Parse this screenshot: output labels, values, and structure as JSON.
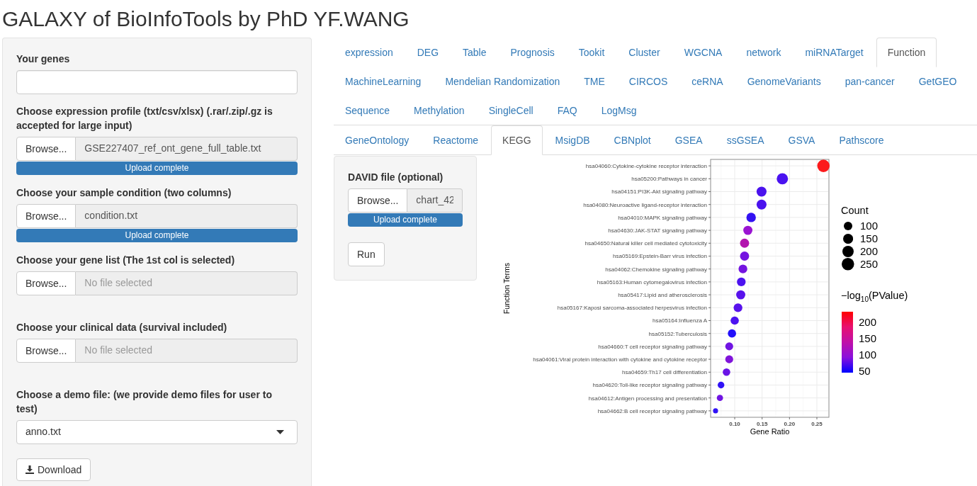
{
  "page_title": "GALAXY of BioInfoTools by PhD YF.WANG",
  "sidebar": {
    "fields": [
      {
        "kind": "text",
        "label": "Your genes"
      },
      {
        "kind": "file",
        "label": "Choose expression profile (txt/csv/xlsx) (.rar/.zip/.gz is accepted for large input)",
        "button": "Browse...",
        "value": "GSE227407_ref_ont_gene_full_table.txt",
        "progress": {
          "label": "Upload complete",
          "level": 1
        }
      },
      {
        "kind": "file",
        "label": "Choose your sample condition (two columns)",
        "button": "Browse...",
        "value": "condition.txt",
        "progress": {
          "label": "Upload complete",
          "level": 1
        }
      },
      {
        "kind": "file",
        "label": "Choose your gene list (The 1st col is selected)",
        "button": "Browse...",
        "placeholder": "No file selected"
      },
      {
        "kind": "file",
        "label": "Choose your clinical data (survival included)",
        "button": "Browse...",
        "placeholder": "No file selected"
      },
      {
        "kind": "select",
        "label": "Choose a demo file: (we provide demo files for user to test)",
        "value": "anno.txt"
      }
    ],
    "download_button": "Download"
  },
  "main_tabs": [
    {
      "label": "expression",
      "selected": false
    },
    {
      "label": "DEG",
      "selected": false
    },
    {
      "label": "Table",
      "selected": false
    },
    {
      "label": "Prognosis",
      "selected": false
    },
    {
      "label": "Tookit",
      "selected": false
    },
    {
      "label": "Cluster",
      "selected": false
    },
    {
      "label": "WGCNA",
      "selected": false
    },
    {
      "label": "network",
      "selected": false
    },
    {
      "label": "miRNATarget",
      "selected": false
    },
    {
      "label": "Function",
      "selected": true
    },
    {
      "label": "MachineLearning",
      "selected": false
    },
    {
      "label": "Mendelian Randomization",
      "selected": false
    },
    {
      "label": "TME",
      "selected": false
    },
    {
      "label": "CIRCOS",
      "selected": false
    },
    {
      "label": "ceRNA",
      "selected": false
    },
    {
      "label": "GenomeVariants",
      "selected": false
    },
    {
      "label": "pan-cancer",
      "selected": false
    },
    {
      "label": "GetGEO",
      "selected": false
    },
    {
      "label": "Sequence",
      "selected": false
    },
    {
      "label": "Methylation",
      "selected": false
    },
    {
      "label": "SingleCell",
      "selected": false
    },
    {
      "label": "FAQ",
      "selected": false
    },
    {
      "label": "LogMsg",
      "selected": false
    }
  ],
  "sub_tabs": [
    {
      "label": "GeneOntology",
      "selected": false
    },
    {
      "label": "Reactome",
      "selected": false
    },
    {
      "label": "KEGG",
      "selected": true
    },
    {
      "label": "MsigDB",
      "selected": false
    },
    {
      "label": "CBNplot",
      "selected": false
    },
    {
      "label": "GSEA",
      "selected": false
    },
    {
      "label": "ssGSEA",
      "selected": false
    },
    {
      "label": "GSVA",
      "selected": false
    },
    {
      "label": "Pathscore",
      "selected": false
    }
  ],
  "kegg_panel": {
    "file_input": {
      "label": "DAVID file (optional)",
      "button": "Browse...",
      "value": "chart_42",
      "progress": {
        "label": "Upload complete",
        "level": 1
      }
    },
    "run_button": "Run"
  },
  "plot": {
    "chart_data": {
      "type": "scatter",
      "orientation": "horizontal",
      "grid": true,
      "xlabel": "Gene Ratio",
      "ylabel": "Function Terms",
      "categories": [
        "hsa04060:Cytokine-cytokine receptor interaction",
        "hsa05200:Pathways in cancer",
        "hsa04151:PI3K-Akt signaling pathway",
        "hsa04080:Neuroactive ligand-receptor interaction",
        "hsa04010:MAPK signaling pathway",
        "hsa04630:JAK-STAT signaling pathway",
        "hsa04650:Natural killer cell mediated cytotoxicity",
        "hsa05169:Epstein-Barr virus infection",
        "hsa04062:Chemokine signaling pathway",
        "hsa05163:Human cytomegalovirus infection",
        "hsa05417:Lipid and atherosclerosis",
        "hsa05167:Kaposi sarcoma-associated herpesvirus infection",
        "hsa05164:Influenza A",
        "hsa05152:Tuberculosis",
        "hsa04660:T cell receptor signaling pathway",
        "hsa04061:Viral protein interaction with cytokine and cytokine receptor",
        "hsa04659:Th17 cell differentiation",
        "hsa04620:Toll-like receptor signaling pathway",
        "hsa04612:Antigen processing and presentation",
        "hsa04662:B cell receptor signaling pathway"
      ],
      "series": [
        {
          "values": [
            0.262,
            0.187,
            0.149,
            0.149,
            0.13,
            0.124,
            0.118,
            0.118,
            0.115,
            0.112,
            0.111,
            0.106,
            0.1,
            0.095,
            0.09,
            0.09,
            0.085,
            0.075,
            0.073,
            0.065
          ],
          "sizes": [
            250,
            196,
            148,
            148,
            131,
            119,
            119,
            119,
            107,
            107,
            119,
            107,
            93,
            93,
            83,
            83,
            73,
            53,
            45,
            24
          ],
          "colors": [
            "#fc1a1c",
            "#4a12f0",
            "#4a12ee",
            "#4a12ee",
            "#3312f2",
            "#9a14d2",
            "#b214ae",
            "#7414e0",
            "#7414e0",
            "#4c12f0",
            "#5812ec",
            "#5812ec",
            "#4c12f0",
            "#2210fa",
            "#7014e2",
            "#8014da",
            "#6a14e6",
            "#3012f6",
            "#7014e2",
            "#3012f6"
          ]
        }
      ],
      "xlim": [
        0.056,
        0.272
      ],
      "xticks": [
        {
          "value": 0.1,
          "label": "0.10"
        },
        {
          "value": 0.15,
          "label": "0.15"
        },
        {
          "value": 0.2,
          "label": "0.20"
        },
        {
          "value": 0.25,
          "label": "0.25"
        }
      ],
      "size_legend": [
        {
          "value": 100,
          "label": "100"
        },
        {
          "value": 150,
          "label": "150"
        },
        {
          "value": 200,
          "label": "200"
        },
        {
          "value": 250,
          "label": "250"
        }
      ]
    },
    "legends": [
      {
        "kind": "size",
        "title": "Count"
      },
      {
        "kind": "colorbar",
        "title": "−log$_{10}$(PValue)",
        "ticks": [
          "200",
          "150",
          "100",
          "50"
        ]
      }
    ]
  }
}
